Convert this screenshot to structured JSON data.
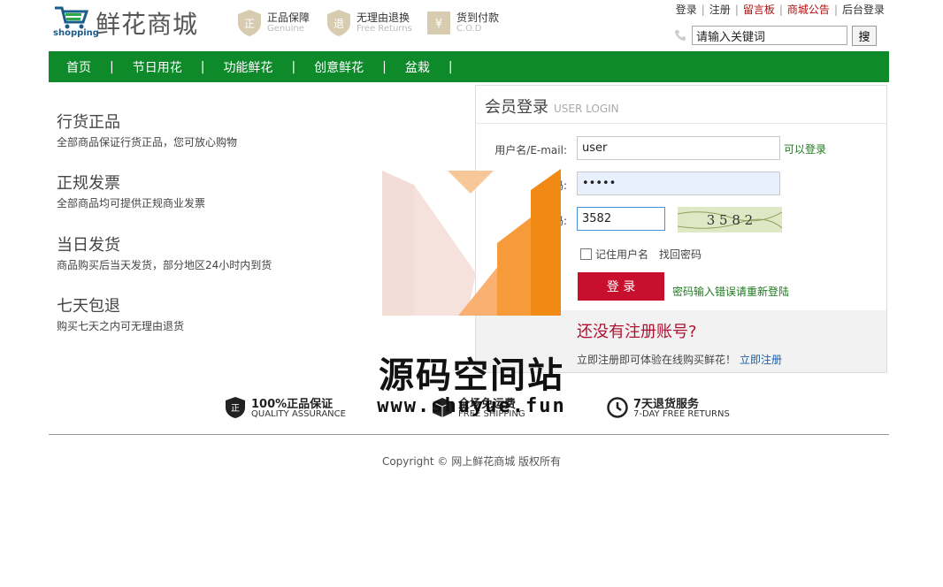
{
  "header": {
    "logo_small": "shopping",
    "logo_title": "鲜花商城",
    "badges": [
      {
        "title": "正品保障",
        "sub": "Genuine"
      },
      {
        "title": "无理由退换",
        "sub": "Free Returns"
      },
      {
        "title": "货到付款",
        "sub": "C.O.D"
      }
    ],
    "toplinks": [
      "登录",
      "注册",
      "留言板",
      "商城公告",
      "后台登录"
    ],
    "search_value": "请输入关键词",
    "search_button": "搜"
  },
  "nav": [
    "首页",
    "节日用花",
    "功能鲜花",
    "创意鲜花",
    "盆栽"
  ],
  "features": [
    {
      "title": "行货正品",
      "desc": "全部商品保证行货正品，您可放心购物"
    },
    {
      "title": "正规发票",
      "desc": "全部商品均可提供正规商业发票"
    },
    {
      "title": "当日发货",
      "desc": "商品购买后当天发货，部分地区24小时内到货"
    },
    {
      "title": "七天包退",
      "desc": "购买七天之内可无理由退货"
    }
  ],
  "login": {
    "title": "会员登录",
    "subtitle": "USER LOGIN",
    "username_label": "用户名/E-mail:",
    "username_value": "user",
    "username_tip": "可以登录",
    "password_label": "密码:",
    "password_value": "•••••",
    "captcha_label": "验证码:",
    "captcha_value": "3582",
    "captcha_image_text": "3 5 8 2",
    "remember_label": "记住用户名",
    "forgot_label": "找回密码",
    "login_button": "登 录",
    "error_tip": "密码输入错误请重新登陆",
    "register_title": "还没有注册账号?",
    "register_desc": "立即注册即可体验在线购买鲜花！",
    "register_link": "立即注册"
  },
  "services": [
    {
      "title": "100%正品保证",
      "sub": "QUALITY ASSURANCE"
    },
    {
      "title": "全场免运费",
      "sub": "FREE SHIPPING"
    },
    {
      "title": "7天退货服务",
      "sub": "7-DAY FREE RETURNS"
    }
  ],
  "copyright": "Copyright © 网上鲜花商城 版权所有",
  "watermark": {
    "title": "源码空间站",
    "url": "www.shuyue.fun"
  },
  "colors": {
    "nav_green": "#0e8a2b",
    "login_red": "#c8102e",
    "link_red": "#b01010"
  }
}
